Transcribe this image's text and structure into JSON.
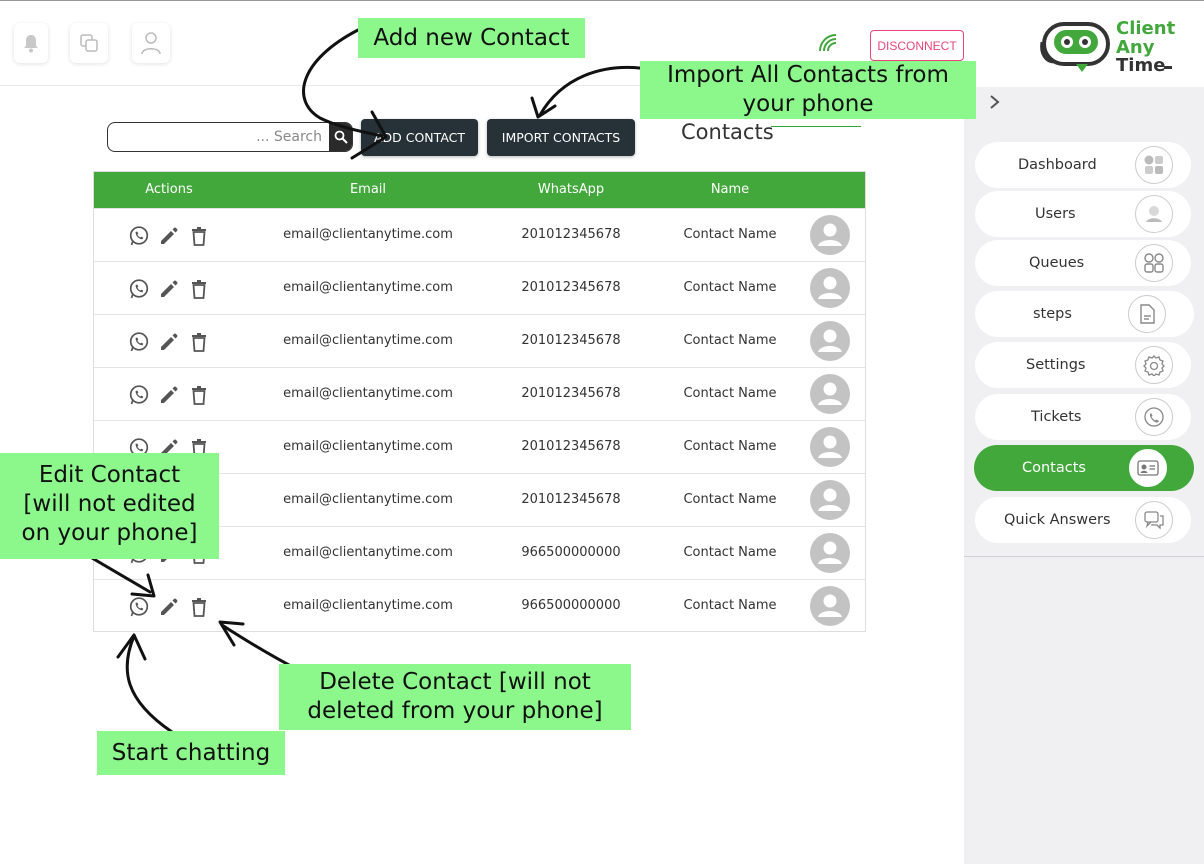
{
  "topbar": {
    "icons": [
      "bell-icon",
      "copy-icon",
      "user-icon"
    ],
    "connection_icon": "wifi-icon",
    "disconnect_label": "DISCONNECT"
  },
  "brand": {
    "logo_lines": [
      "Client",
      "Any",
      "Time"
    ],
    "accent_color": "#42a83c"
  },
  "toolbar": {
    "search_placeholder": "... Search",
    "search_icon": "search-icon",
    "add_label": "ADD CONTACT",
    "import_label": "IMPORT CONTACTS"
  },
  "page": {
    "title": "Contacts"
  },
  "table": {
    "headers": {
      "actions": "Actions",
      "email": "Email",
      "whatsapp": "WhatsApp",
      "name": "Name"
    },
    "rows": [
      {
        "email": "email@clientanytime.com",
        "whatsapp": "201012345678",
        "name": "Contact Name"
      },
      {
        "email": "email@clientanytime.com",
        "whatsapp": "201012345678",
        "name": "Contact Name"
      },
      {
        "email": "email@clientanytime.com",
        "whatsapp": "201012345678",
        "name": "Contact Name"
      },
      {
        "email": "email@clientanytime.com",
        "whatsapp": "201012345678",
        "name": "Contact Name"
      },
      {
        "email": "email@clientanytime.com",
        "whatsapp": "201012345678",
        "name": "Contact Name"
      },
      {
        "email": "email@clientanytime.com",
        "whatsapp": "201012345678",
        "name": "Contact Name"
      },
      {
        "email": "email@clientanytime.com",
        "whatsapp": "966500000000",
        "name": "Contact Name"
      },
      {
        "email": "email@clientanytime.com",
        "whatsapp": "966500000000",
        "name": "Contact Name"
      }
    ]
  },
  "sidebar": {
    "items": [
      {
        "label": "Dashboard",
        "icon": "dashboard-icon"
      },
      {
        "label": "Users",
        "icon": "users-icon"
      },
      {
        "label": "Queues",
        "icon": "queues-icon"
      },
      {
        "label": "steps",
        "icon": "document-icon"
      },
      {
        "label": "Settings",
        "icon": "settings-icon"
      },
      {
        "label": "Tickets",
        "icon": "phone-icon"
      },
      {
        "label": "Contacts",
        "icon": "contact-card-icon",
        "active": true
      },
      {
        "label": "Quick Answers",
        "icon": "chat-icon"
      }
    ],
    "active_color": "#42a83c"
  },
  "callouts": {
    "add": "Add new Contact",
    "import": [
      "Import All Contacts from",
      "your phone"
    ],
    "edit": [
      "Edit Contact",
      "[will not edited",
      "on your phone]"
    ],
    "delete": [
      "Delete Contact [will not",
      "deleted from your phone]"
    ],
    "chat": "Start chatting",
    "color": "#8cf78b"
  }
}
